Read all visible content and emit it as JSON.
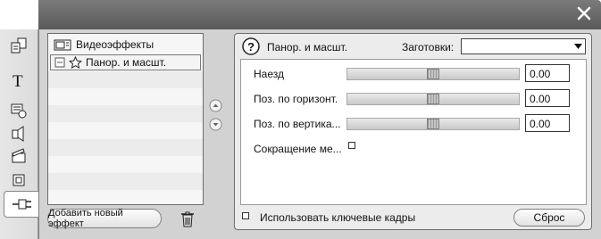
{
  "effects_list": {
    "root_label": "Видеоэффекты",
    "selected_label": "Панор. и масшт."
  },
  "buttons": {
    "add_effect": "Добавить новый эффект",
    "reset": "Сброс"
  },
  "settings": {
    "title": "Панор. и масшт.",
    "presets_label": "Заготовки:",
    "presets_value": "",
    "params": [
      {
        "label": "Наезд",
        "value": "0.00",
        "level": 0.5
      },
      {
        "label": "Поз. по горизонт.",
        "value": "0.00",
        "level": 0.5
      },
      {
        "label": "Поз. по вертика...",
        "value": "0.00",
        "level": 0.5
      }
    ],
    "reduction_label": "Сокращение ме...",
    "keyframes_label": "Использовать ключевые кадры"
  },
  "icons": {
    "close": "close-icon",
    "help": "help-icon",
    "trash": "trash-icon"
  },
  "colors": {
    "titlebar": "#6a6a6a",
    "frame": "#d2d2d2"
  }
}
